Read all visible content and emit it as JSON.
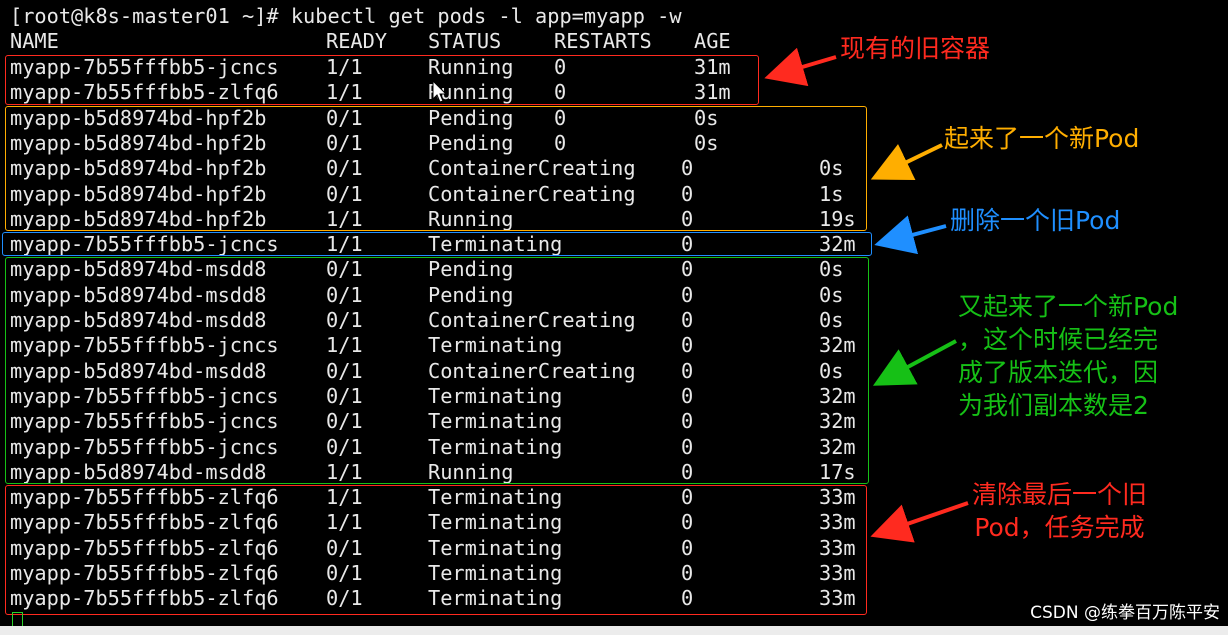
{
  "terminal": {
    "command_line": "[root@k8s-master01 ~]# kubectl get pods -l app=myapp -w",
    "header": {
      "name": "NAME",
      "ready": "READY",
      "status": "STATUS",
      "restarts": "RESTARTS",
      "age": "AGE"
    },
    "rows": [
      {
        "name": "myapp-7b55fffbb5-jcncs",
        "ready": "1/1",
        "status": "Running",
        "restarts": "0",
        "age": "31m"
      },
      {
        "name": "myapp-7b55fffbb5-zlfq6",
        "ready": "1/1",
        "status": "Running",
        "restarts": "0",
        "age": "31m"
      },
      {
        "name": "myapp-b5d8974bd-hpf2b",
        "ready": "0/1",
        "status": "Pending",
        "restarts": "0",
        "age": "0s"
      },
      {
        "name": "myapp-b5d8974bd-hpf2b",
        "ready": "0/1",
        "status": "Pending",
        "restarts": "0",
        "age": "0s"
      },
      {
        "name": "myapp-b5d8974bd-hpf2b",
        "ready": "0/1",
        "status": "ContainerCreating",
        "restarts": "0",
        "age": "0s"
      },
      {
        "name": "myapp-b5d8974bd-hpf2b",
        "ready": "0/1",
        "status": "ContainerCreating",
        "restarts": "0",
        "age": "1s"
      },
      {
        "name": "myapp-b5d8974bd-hpf2b",
        "ready": "1/1",
        "status": "Running",
        "restarts": "0",
        "age": "19s"
      },
      {
        "name": "myapp-7b55fffbb5-jcncs",
        "ready": "1/1",
        "status": "Terminating",
        "restarts": "0",
        "age": "32m"
      },
      {
        "name": "myapp-b5d8974bd-msdd8",
        "ready": "0/1",
        "status": "Pending",
        "restarts": "0",
        "age": "0s"
      },
      {
        "name": "myapp-b5d8974bd-msdd8",
        "ready": "0/1",
        "status": "Pending",
        "restarts": "0",
        "age": "0s"
      },
      {
        "name": "myapp-b5d8974bd-msdd8",
        "ready": "0/1",
        "status": "ContainerCreating",
        "restarts": "0",
        "age": "0s"
      },
      {
        "name": "myapp-7b55fffbb5-jcncs",
        "ready": "1/1",
        "status": "Terminating",
        "restarts": "0",
        "age": "32m"
      },
      {
        "name": "myapp-b5d8974bd-msdd8",
        "ready": "0/1",
        "status": "ContainerCreating",
        "restarts": "0",
        "age": "0s"
      },
      {
        "name": "myapp-7b55fffbb5-jcncs",
        "ready": "0/1",
        "status": "Terminating",
        "restarts": "0",
        "age": "32m"
      },
      {
        "name": "myapp-7b55fffbb5-jcncs",
        "ready": "0/1",
        "status": "Terminating",
        "restarts": "0",
        "age": "32m"
      },
      {
        "name": "myapp-7b55fffbb5-jcncs",
        "ready": "0/1",
        "status": "Terminating",
        "restarts": "0",
        "age": "32m"
      },
      {
        "name": "myapp-b5d8974bd-msdd8",
        "ready": "1/1",
        "status": "Running",
        "restarts": "0",
        "age": "17s"
      },
      {
        "name": "myapp-7b55fffbb5-zlfq6",
        "ready": "1/1",
        "status": "Terminating",
        "restarts": "0",
        "age": "33m"
      },
      {
        "name": "myapp-7b55fffbb5-zlfq6",
        "ready": "1/1",
        "status": "Terminating",
        "restarts": "0",
        "age": "33m"
      },
      {
        "name": "myapp-7b55fffbb5-zlfq6",
        "ready": "0/1",
        "status": "Terminating",
        "restarts": "0",
        "age": "33m"
      },
      {
        "name": "myapp-7b55fffbb5-zlfq6",
        "ready": "0/1",
        "status": "Terminating",
        "restarts": "0",
        "age": "33m"
      },
      {
        "name": "myapp-7b55fffbb5-zlfq6",
        "ready": "0/1",
        "status": "Terminating",
        "restarts": "0",
        "age": "33m"
      }
    ]
  },
  "annotations": {
    "old_containers": "现有的旧容器",
    "new_pod": "起来了一个新Pod",
    "delete_old": "删除一个旧Pod",
    "new_pod_again": "又起来了一个新Pod\n，这个时候已经完\n成了版本迭代，因\n为我们副本数是2",
    "cleanup": "清除最后一个旧\nPod，任务完成"
  },
  "colors": {
    "red": "#ff2a1f",
    "orange": "#ffae00",
    "blue": "#1f8fff",
    "green": "#16c016",
    "text": "#e8e8e8"
  },
  "watermark": "CSDN @练拳百万陈平安"
}
